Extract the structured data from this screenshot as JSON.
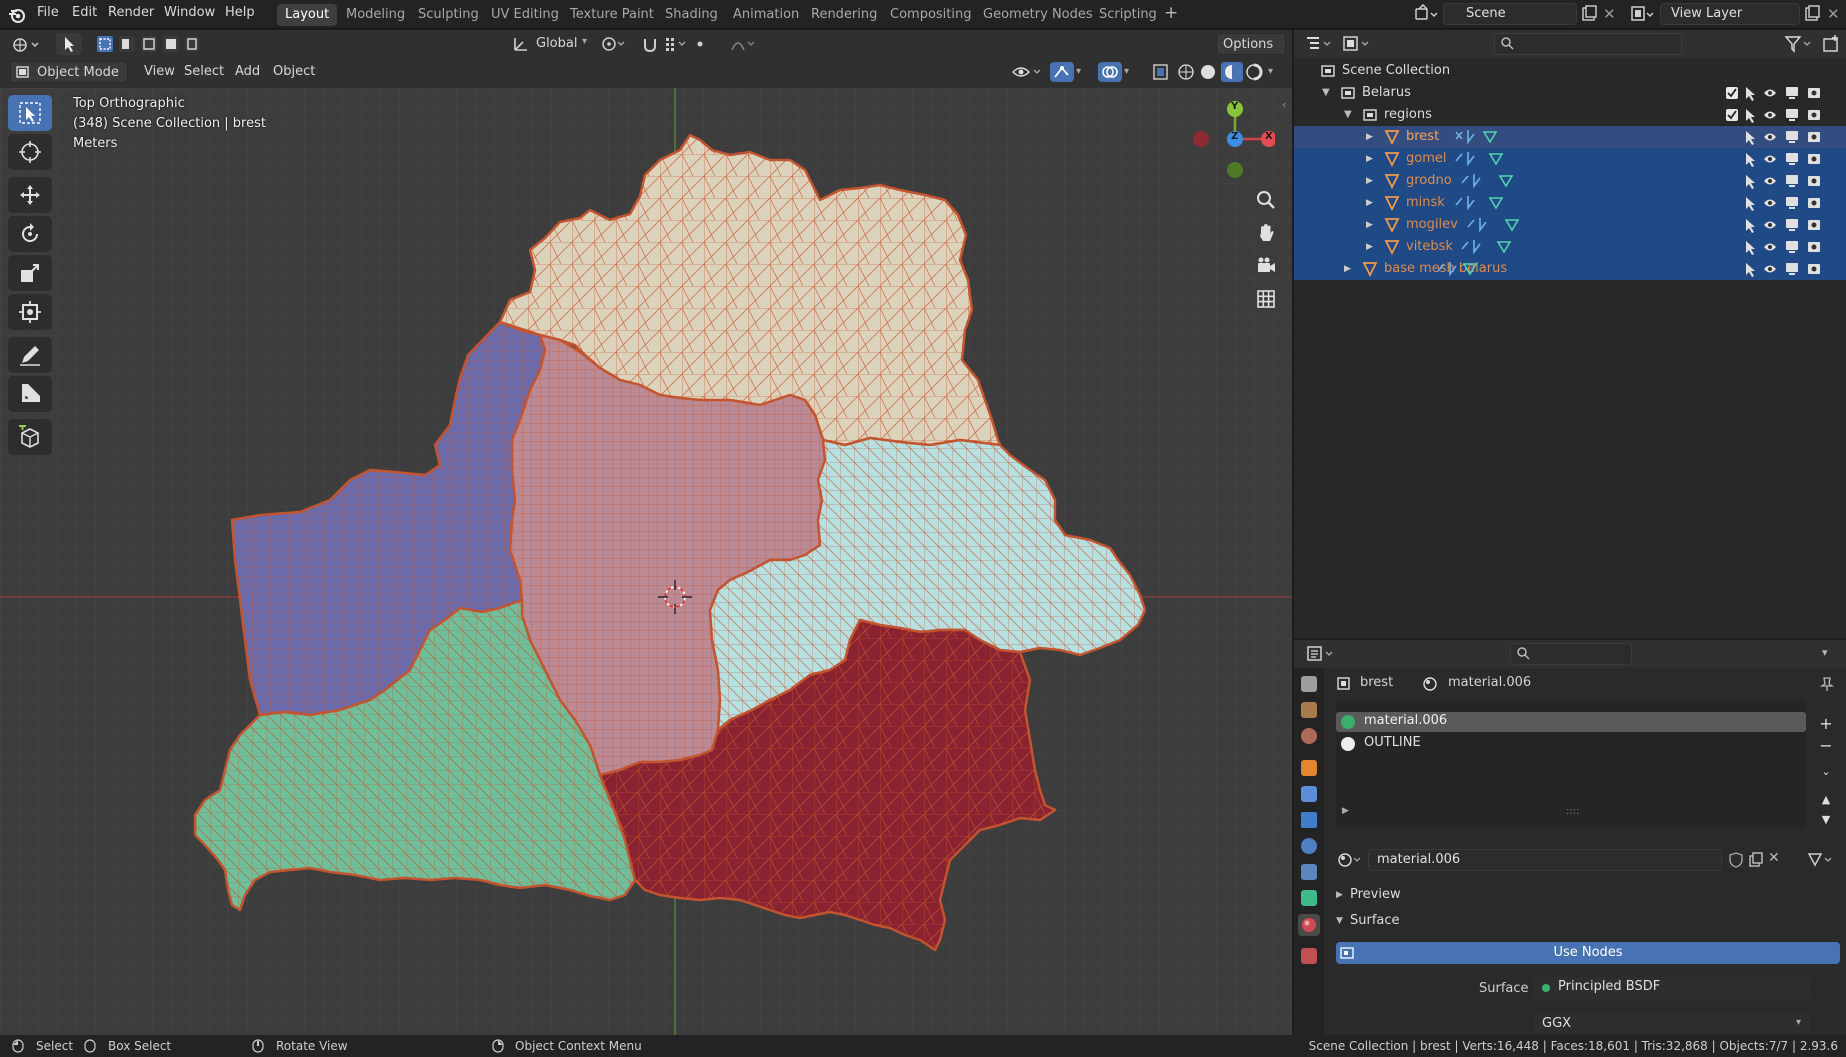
{
  "menubar": {
    "items": [
      "File",
      "Edit",
      "Render",
      "Window",
      "Help"
    ],
    "workspaces": [
      "Layout",
      "Modeling",
      "Sculpting",
      "UV Editing",
      "Texture Paint",
      "Shading",
      "Animation",
      "Rendering",
      "Compositing",
      "Geometry Nodes",
      "Scripting"
    ],
    "active_workspace": "Layout",
    "scene": "Scene",
    "view_layer": "View Layer"
  },
  "viewport_header": {
    "transform_orientation": "Global",
    "options": "Options",
    "mode": "Object Mode",
    "menus": [
      "View",
      "Select",
      "Add",
      "Object"
    ]
  },
  "viewport_overlay": {
    "view_name": "Top Orthographic",
    "collection_info": "(348) Scene Collection | brest",
    "units": "Meters"
  },
  "gizmo": {
    "y": "Y",
    "z": "Z",
    "x": "X"
  },
  "outliner": {
    "root": "Scene Collection",
    "collection": "Belarus",
    "sub_collection": "regions",
    "objects": [
      "brest",
      "gomel",
      "grodno",
      "minsk",
      "mogilev",
      "vitebsk"
    ],
    "base_mesh": "base mesh belarus"
  },
  "properties": {
    "object_name": "brest",
    "material_name": "material.006",
    "slots": [
      "material.006",
      "OUTLINE"
    ],
    "material_field": "material.006",
    "sections": {
      "preview": "Preview",
      "surface": "Surface"
    },
    "use_nodes": "Use Nodes",
    "surface_label": "Surface",
    "surface_value": "Principled BSDF",
    "distribution": "GGX"
  },
  "statusbar": {
    "select": "Select",
    "box_select": "Box Select",
    "rotate_view": "Rotate View",
    "context_menu": "Object Context Menu",
    "stats": "Scene Collection | brest | Verts:16,448 | Faces:18,601 | Tris:32,868 | Objects:7/7 | 2.93.6"
  },
  "colors": {
    "accent": "#4772b3",
    "selection": "#1f4a86",
    "vitebsk": "#dcd3bc",
    "grodno": "#6b6aaa",
    "minsk": "#bb8a95",
    "mogilev": "#b6e1e3",
    "brest": "#6dc09b",
    "gomel": "#8a2331",
    "edge": "#c4542f"
  }
}
